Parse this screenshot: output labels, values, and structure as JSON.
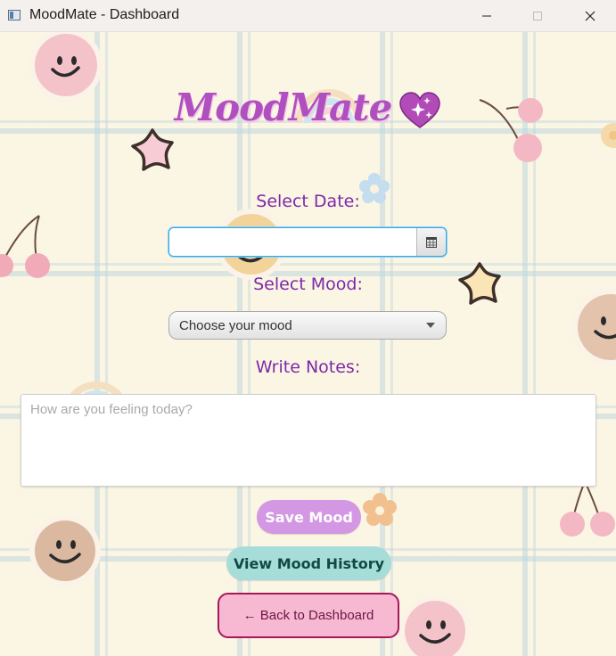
{
  "window": {
    "title": "MoodMate - Dashboard",
    "controls": {
      "minimize": "—",
      "maximize": "☐",
      "close": "✕"
    }
  },
  "app": {
    "title": "MoodMate"
  },
  "form": {
    "date_label": "Select Date:",
    "date_value": "",
    "mood_label": "Select Mood:",
    "mood_selected": "Choose your mood",
    "notes_label": "Write Notes:",
    "notes_placeholder": "How are you feeling today?"
  },
  "buttons": {
    "save": "Save Mood",
    "history": "View Mood History",
    "back": "← Back to Dashboard"
  },
  "colors": {
    "title_purple": "#b04fc0",
    "label_purple": "#7b2aa8",
    "save_button": "#d397e3",
    "history_button": "#a7ddd9",
    "back_button": "#f7b9d1",
    "back_border": "#a6175c"
  }
}
